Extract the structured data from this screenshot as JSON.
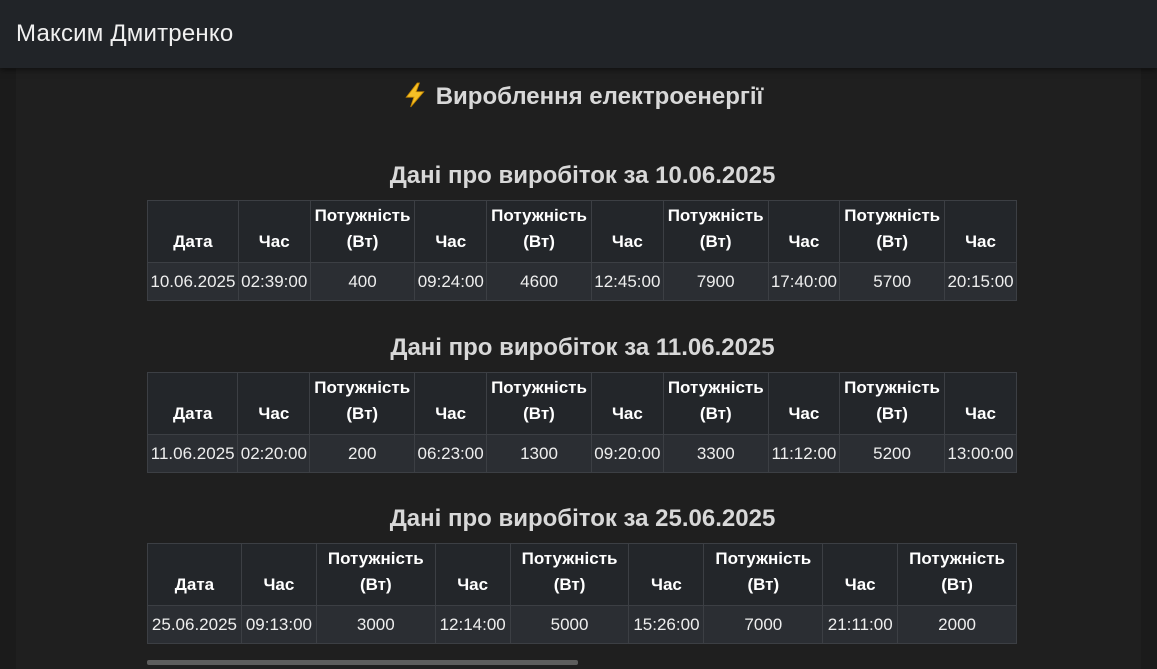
{
  "header": {
    "user_name": "Максим Дмитренко"
  },
  "page": {
    "title": "Вироблення електроенергії"
  },
  "sections": [
    {
      "heading": "Дані про виробіток за 10.06.2025",
      "headers": [
        "Дата",
        "Час",
        "Потужність (Вт)",
        "Час",
        "Потужність (Вт)",
        "Час",
        "Потужність (Вт)",
        "Час",
        "Потужність (Вт)",
        "Час"
      ],
      "row": [
        "10.06.2025",
        "02:39:00",
        "400",
        "09:24:00",
        "4600",
        "12:45:00",
        "7900",
        "17:40:00",
        "5700",
        "20:15:00"
      ]
    },
    {
      "heading": "Дані про виробіток за 11.06.2025",
      "headers": [
        "Дата",
        "Час",
        "Потужність (Вт)",
        "Час",
        "Потужність (Вт)",
        "Час",
        "Потужність (Вт)",
        "Час",
        "Потужність (Вт)",
        "Час"
      ],
      "row": [
        "11.06.2025",
        "02:20:00",
        "200",
        "06:23:00",
        "1300",
        "09:20:00",
        "3300",
        "11:12:00",
        "5200",
        "13:00:00"
      ]
    },
    {
      "heading": "Дані про виробіток за 25.06.2025",
      "headers": [
        "Дата",
        "Час",
        "Потужність (Вт)",
        "Час",
        "Потужність (Вт)",
        "Час",
        "Потужність (Вт)",
        "Час",
        "Потужність (Вт)"
      ],
      "row": [
        "25.06.2025",
        "09:13:00",
        "3000",
        "12:14:00",
        "5000",
        "15:26:00",
        "7000",
        "21:11:00",
        "2000"
      ]
    }
  ]
}
